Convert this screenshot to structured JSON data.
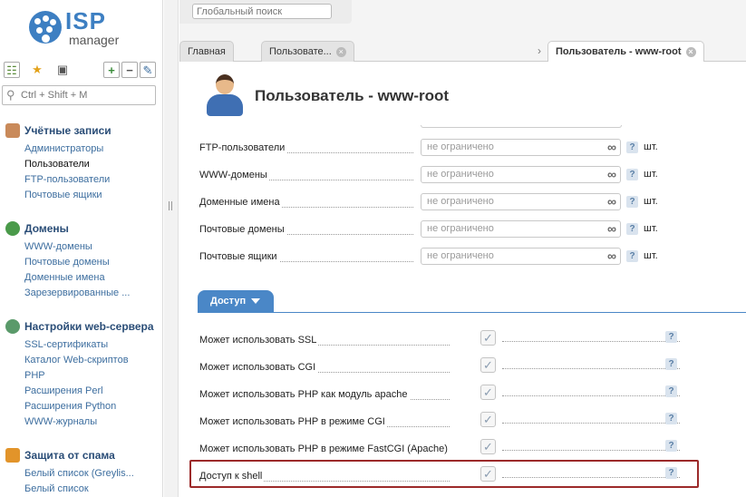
{
  "app": {
    "logo_isp": "ISP",
    "logo_manager": "manager"
  },
  "sidebar": {
    "search_placeholder": "Ctrl + Shift + M",
    "sections": [
      {
        "title": "Учётные записи",
        "items": [
          "Администраторы",
          "Пользователи",
          "FTP-пользователи",
          "Почтовые ящики"
        ]
      },
      {
        "title": "Домены",
        "items": [
          "WWW-домены",
          "Почтовые домены",
          "Доменные имена",
          "Зарезервированные ..."
        ]
      },
      {
        "title": "Настройки web-сервера",
        "items": [
          "SSL-сертификаты",
          "Каталог Web-скриптов",
          "PHP",
          "Расширения Perl",
          "Расширения Python",
          "WWW-журналы"
        ]
      },
      {
        "title": "Защита от спама",
        "items": [
          "Белый список (Greylis...",
          "Белый список"
        ]
      }
    ]
  },
  "topbar": {
    "global_search_placeholder": "Глобальный поиск",
    "tabs": [
      "Главная",
      "Пользовате...",
      "Пользователь - www-root"
    ]
  },
  "page": {
    "title": "Пользователь - www-root"
  },
  "limits": [
    {
      "label": "FTP-пользователи",
      "value": "не ограничено",
      "unit": "шт."
    },
    {
      "label": "WWW-домены",
      "value": "не ограничено",
      "unit": "шт."
    },
    {
      "label": "Доменные имена",
      "value": "не ограничено",
      "unit": "шт."
    },
    {
      "label": "Почтовые домены",
      "value": "не ограничено",
      "unit": "шт."
    },
    {
      "label": "Почтовые ящики",
      "value": "не ограничено",
      "unit": "шт."
    }
  ],
  "access": {
    "section_label": "Доступ",
    "options": [
      {
        "label": "Может использовать SSL",
        "checked": true
      },
      {
        "label": "Может использовать CGI",
        "checked": true
      },
      {
        "label": "Может использовать PHP как модуль apache",
        "checked": true
      },
      {
        "label": "Может использовать PHP в режиме CGI",
        "checked": true
      },
      {
        "label": "Может использовать PHP в режиме FastCGI (Apache)",
        "checked": true
      },
      {
        "label": "Доступ к shell",
        "checked": true
      }
    ]
  },
  "icons": {
    "help": "?",
    "infinity": "∞",
    "check": "✓",
    "close": "×",
    "arrow": "›"
  },
  "colors": {
    "accent": "#4a87c7",
    "highlight_border": "#9c2a2a",
    "link": "#3d6e9f"
  }
}
